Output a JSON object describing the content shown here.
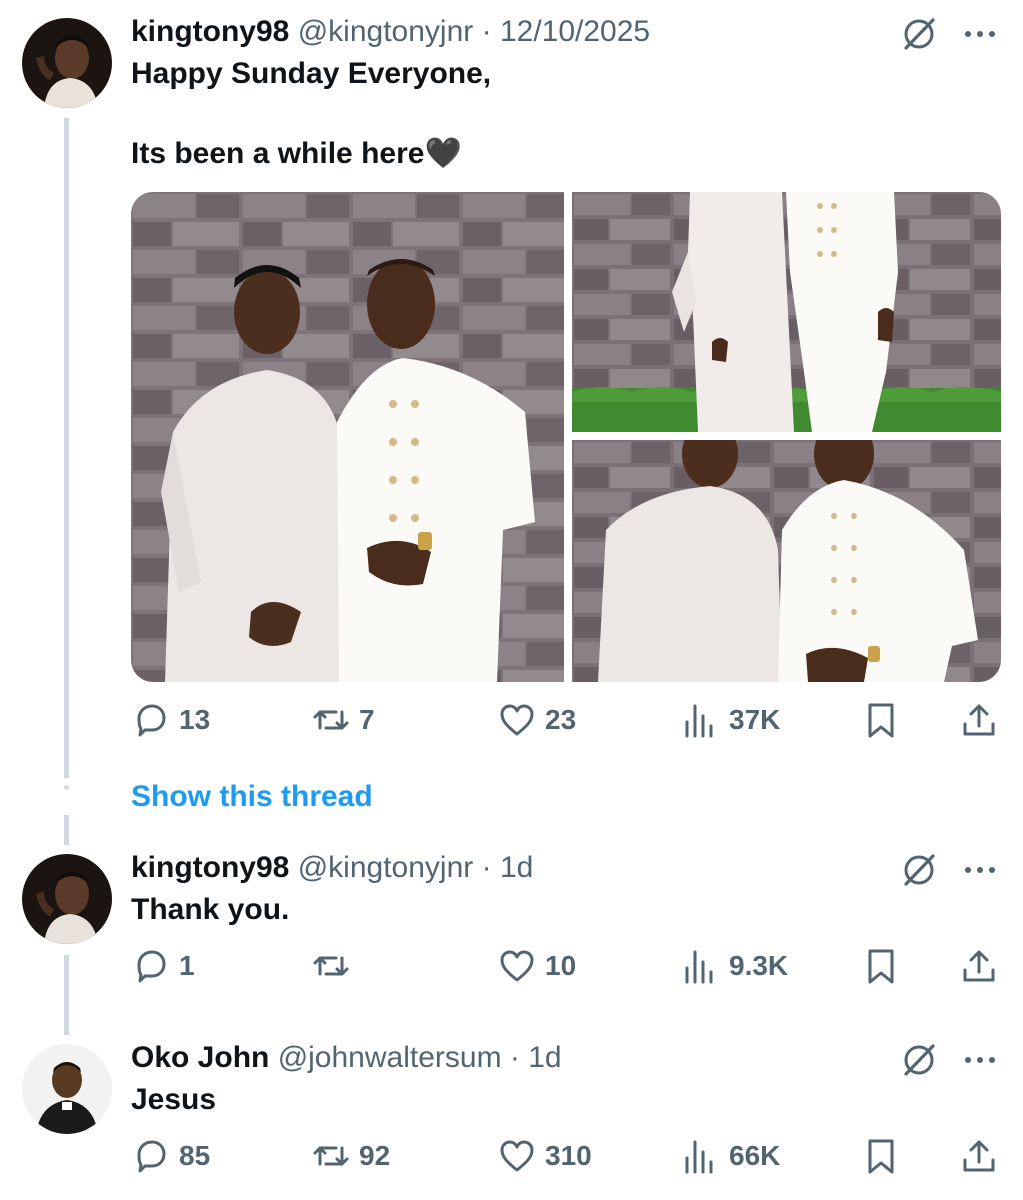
{
  "tweets": [
    {
      "name": "kingtony98",
      "handle": "@kingtonyjnr",
      "separator": "·",
      "time": "12/10/2025",
      "text_line1": "Happy Sunday Everyone,",
      "text_line2": "Its been a while here🖤",
      "replies": "13",
      "reposts": "7",
      "likes": "23",
      "views": "37K"
    },
    {
      "name": "kingtony98",
      "handle": "@kingtonyjnr",
      "separator": "·",
      "time": "1d",
      "text": "Thank you.",
      "replies": "1",
      "reposts": "",
      "likes": "10",
      "views": "9.3K"
    },
    {
      "name": "Oko John",
      "handle": "@johnwaltersum",
      "separator": "·",
      "time": "1d",
      "text": "Jesus",
      "replies": "85",
      "reposts": "92",
      "likes": "310",
      "views": "66K"
    }
  ],
  "show_thread_label": "Show this thread",
  "icons": {
    "reply": "reply-icon",
    "repost": "repost-icon",
    "like": "like-icon",
    "views": "views-icon",
    "bookmark": "bookmark-icon",
    "share": "share-icon",
    "grok": "grok-icon",
    "more": "more-icon"
  },
  "colors": {
    "text": "#0f1419",
    "muted": "#536471",
    "link": "#1d9bf0",
    "thread_line": "#cfd9de"
  }
}
